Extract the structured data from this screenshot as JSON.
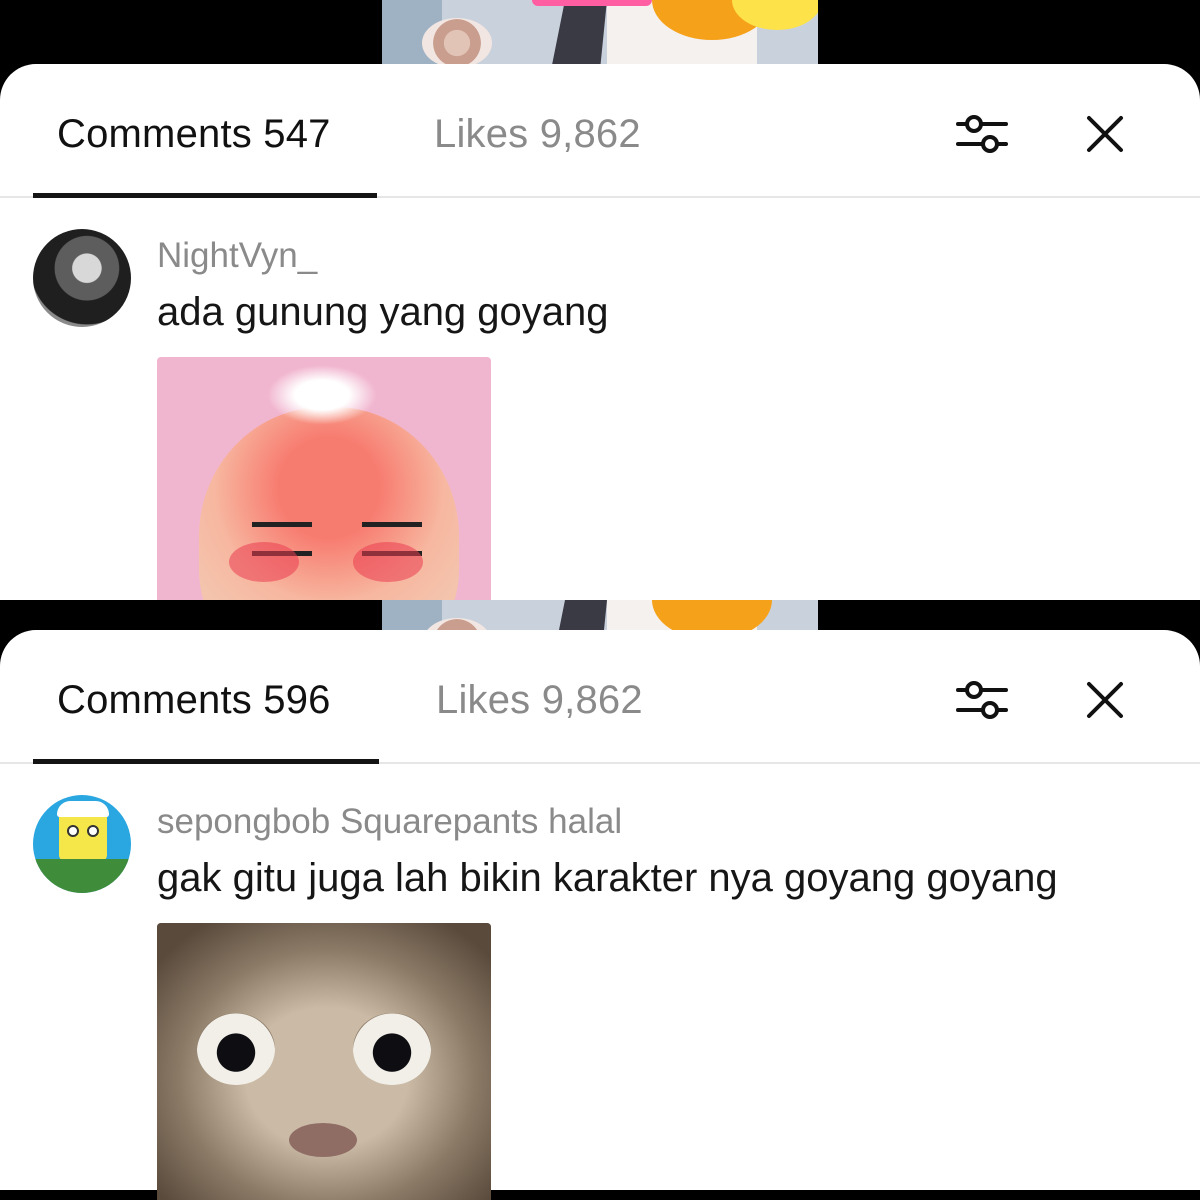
{
  "screens": [
    {
      "comments_tab": "Comments 547",
      "likes_tab": "Likes 9,862",
      "filter_icon": "sliders-icon",
      "close_icon": "close-icon",
      "comment": {
        "username": "NightVyn_",
        "text": "ada gunung yang goyang"
      }
    },
    {
      "comments_tab": "Comments 596",
      "likes_tab": "Likes 9,862",
      "filter_icon": "sliders-icon",
      "close_icon": "close-icon",
      "comment": {
        "username": "sepongbob Squarepants halal",
        "text": "gak gitu juga lah bikin karakter nya goyang goyang"
      }
    }
  ],
  "colors": {
    "sheet_bg": "#ffffff",
    "active_text": "#111111",
    "inactive_text": "#8a8a8a",
    "divider": "#e6e6e6"
  }
}
